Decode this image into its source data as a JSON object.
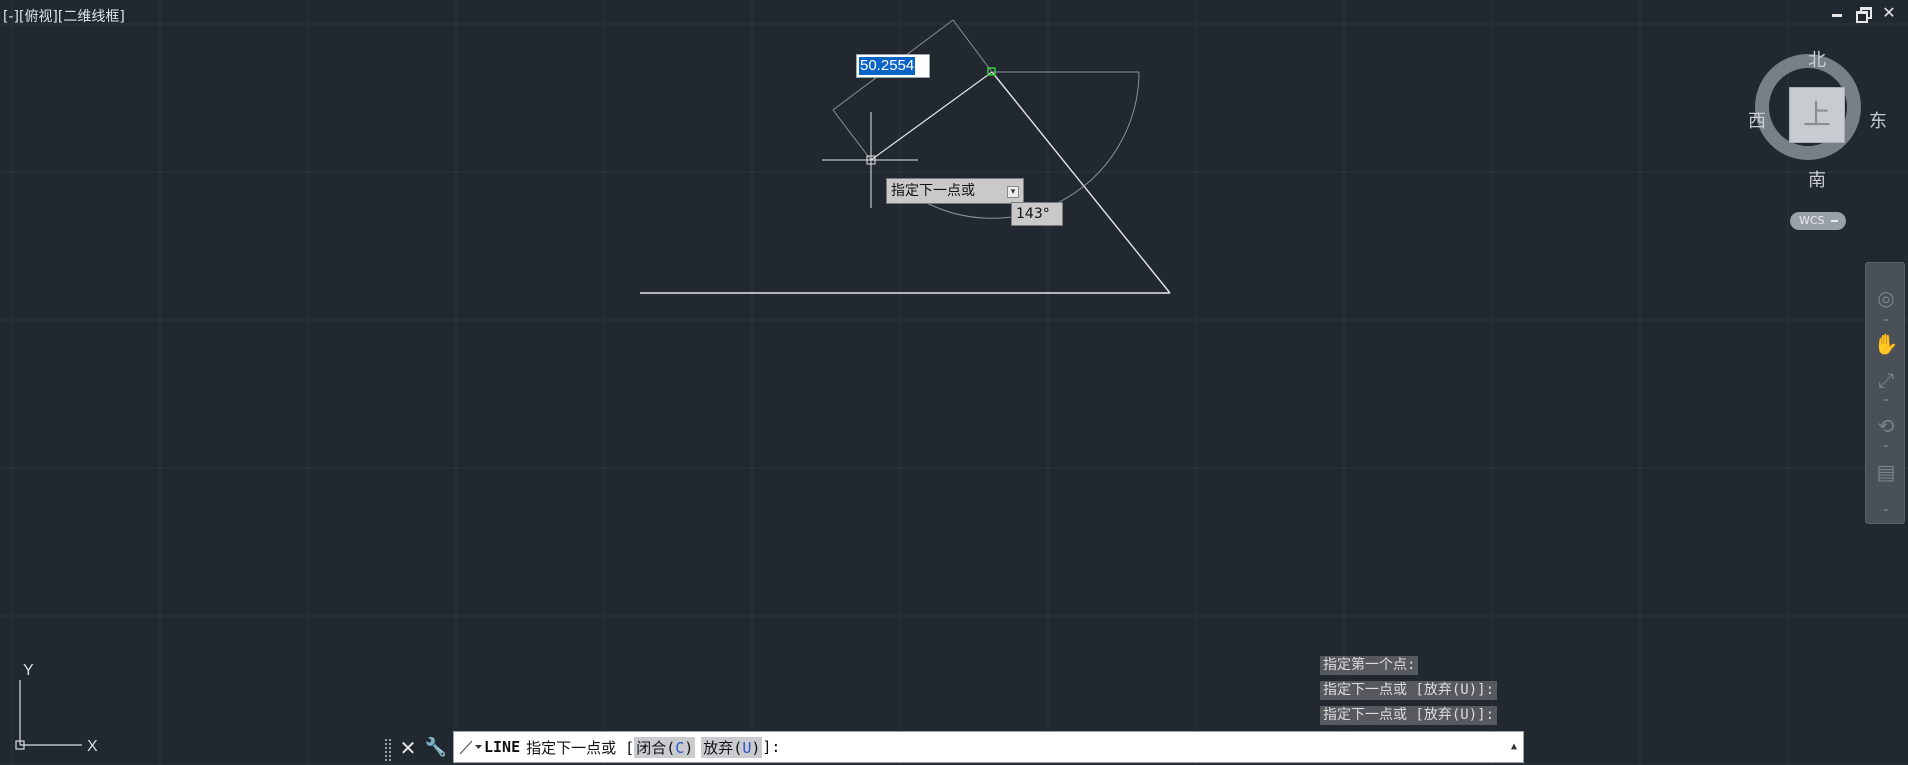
{
  "viewport": {
    "label": "[-][俯视][二维线框]"
  },
  "window_controls": {
    "minimize_icon": "minimize-icon",
    "restore_icon": "restore-icon",
    "close_icon": "close-icon"
  },
  "dynamic_input": {
    "length_value": "50.2554",
    "prompt": "指定下一点或",
    "angle": "143°"
  },
  "viewcube": {
    "face": "上",
    "north": "北",
    "south": "南",
    "west": "西",
    "east": "东",
    "wcs_label": "WCS"
  },
  "ucs": {
    "x": "X",
    "y": "Y"
  },
  "command_history": [
    "指定第一个点:",
    "指定下一点或 [放弃(U)]:",
    "指定下一点或 [放弃(U)]:"
  ],
  "command_line": {
    "command": "LINE",
    "prompt": "指定下一点或 [",
    "option1_text": "闭合(",
    "option1_key": "C",
    "option1_close": ")",
    "option2_text": "放弃(",
    "option2_key": "U",
    "option2_close": ")",
    "suffix": "]:"
  },
  "colors": {
    "background": "#212830",
    "grid_line": "#2d353f",
    "geometry": "#e6e6e6",
    "selection": "#0a64c8",
    "snap_marker": "#39c93a"
  }
}
